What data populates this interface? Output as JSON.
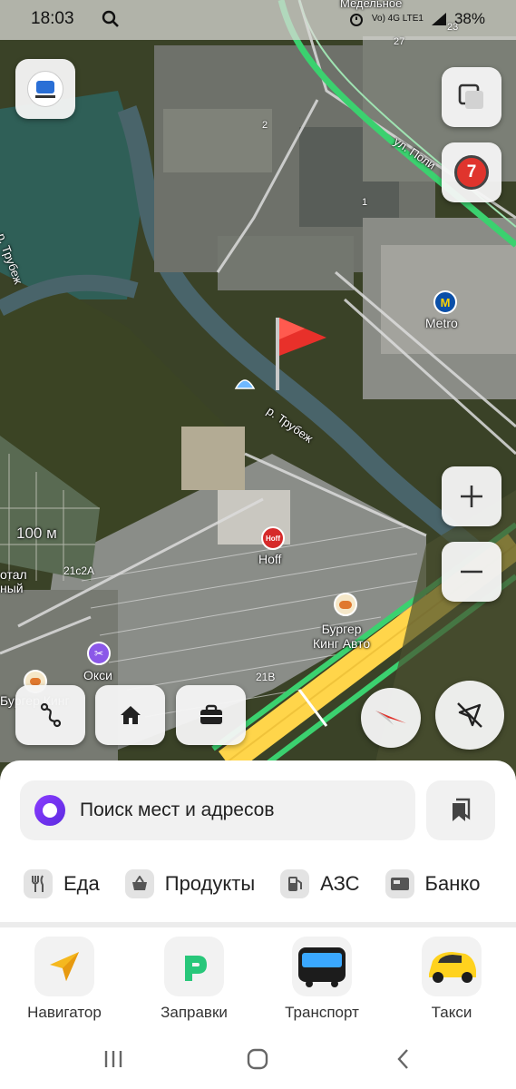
{
  "status_bar": {
    "time": "18:03",
    "network": "Vo) 4G LTE1",
    "battery": "38%"
  },
  "map": {
    "labels": {
      "river1": "р. Трубеж",
      "river2": "р. Трубеж",
      "street": "ул. Поли",
      "metro": "Metro",
      "hoff": "Hoff",
      "burger": "Бургер\nКинг Авто",
      "oksi": "Окси",
      "scale": "100 м",
      "left1": "отал",
      "left2": "ный",
      "b21c2a": "21с2А",
      "b21v": "21В",
      "b2": "2",
      "b1": "1",
      "b27": "27",
      "b23": "23",
      "burger_left": "Бургер Кинг",
      "top_cut": "Медельное"
    },
    "traffic_badge": "7"
  },
  "sheet": {
    "search_placeholder": "Поиск мест и адресов",
    "categories": [
      "Еда",
      "Продукты",
      "АЗС",
      "Банко"
    ]
  },
  "apps": [
    {
      "label": "Навигатор"
    },
    {
      "label": "Заправки"
    },
    {
      "label": "Транспорт"
    },
    {
      "label": "Такси"
    }
  ],
  "colors": {
    "accent_alice": "#7a35f0",
    "traffic_red": "#e0342d",
    "road_green": "#3bd16f",
    "road_yellow": "#ffd54a",
    "flag_red": "#e8302a"
  }
}
